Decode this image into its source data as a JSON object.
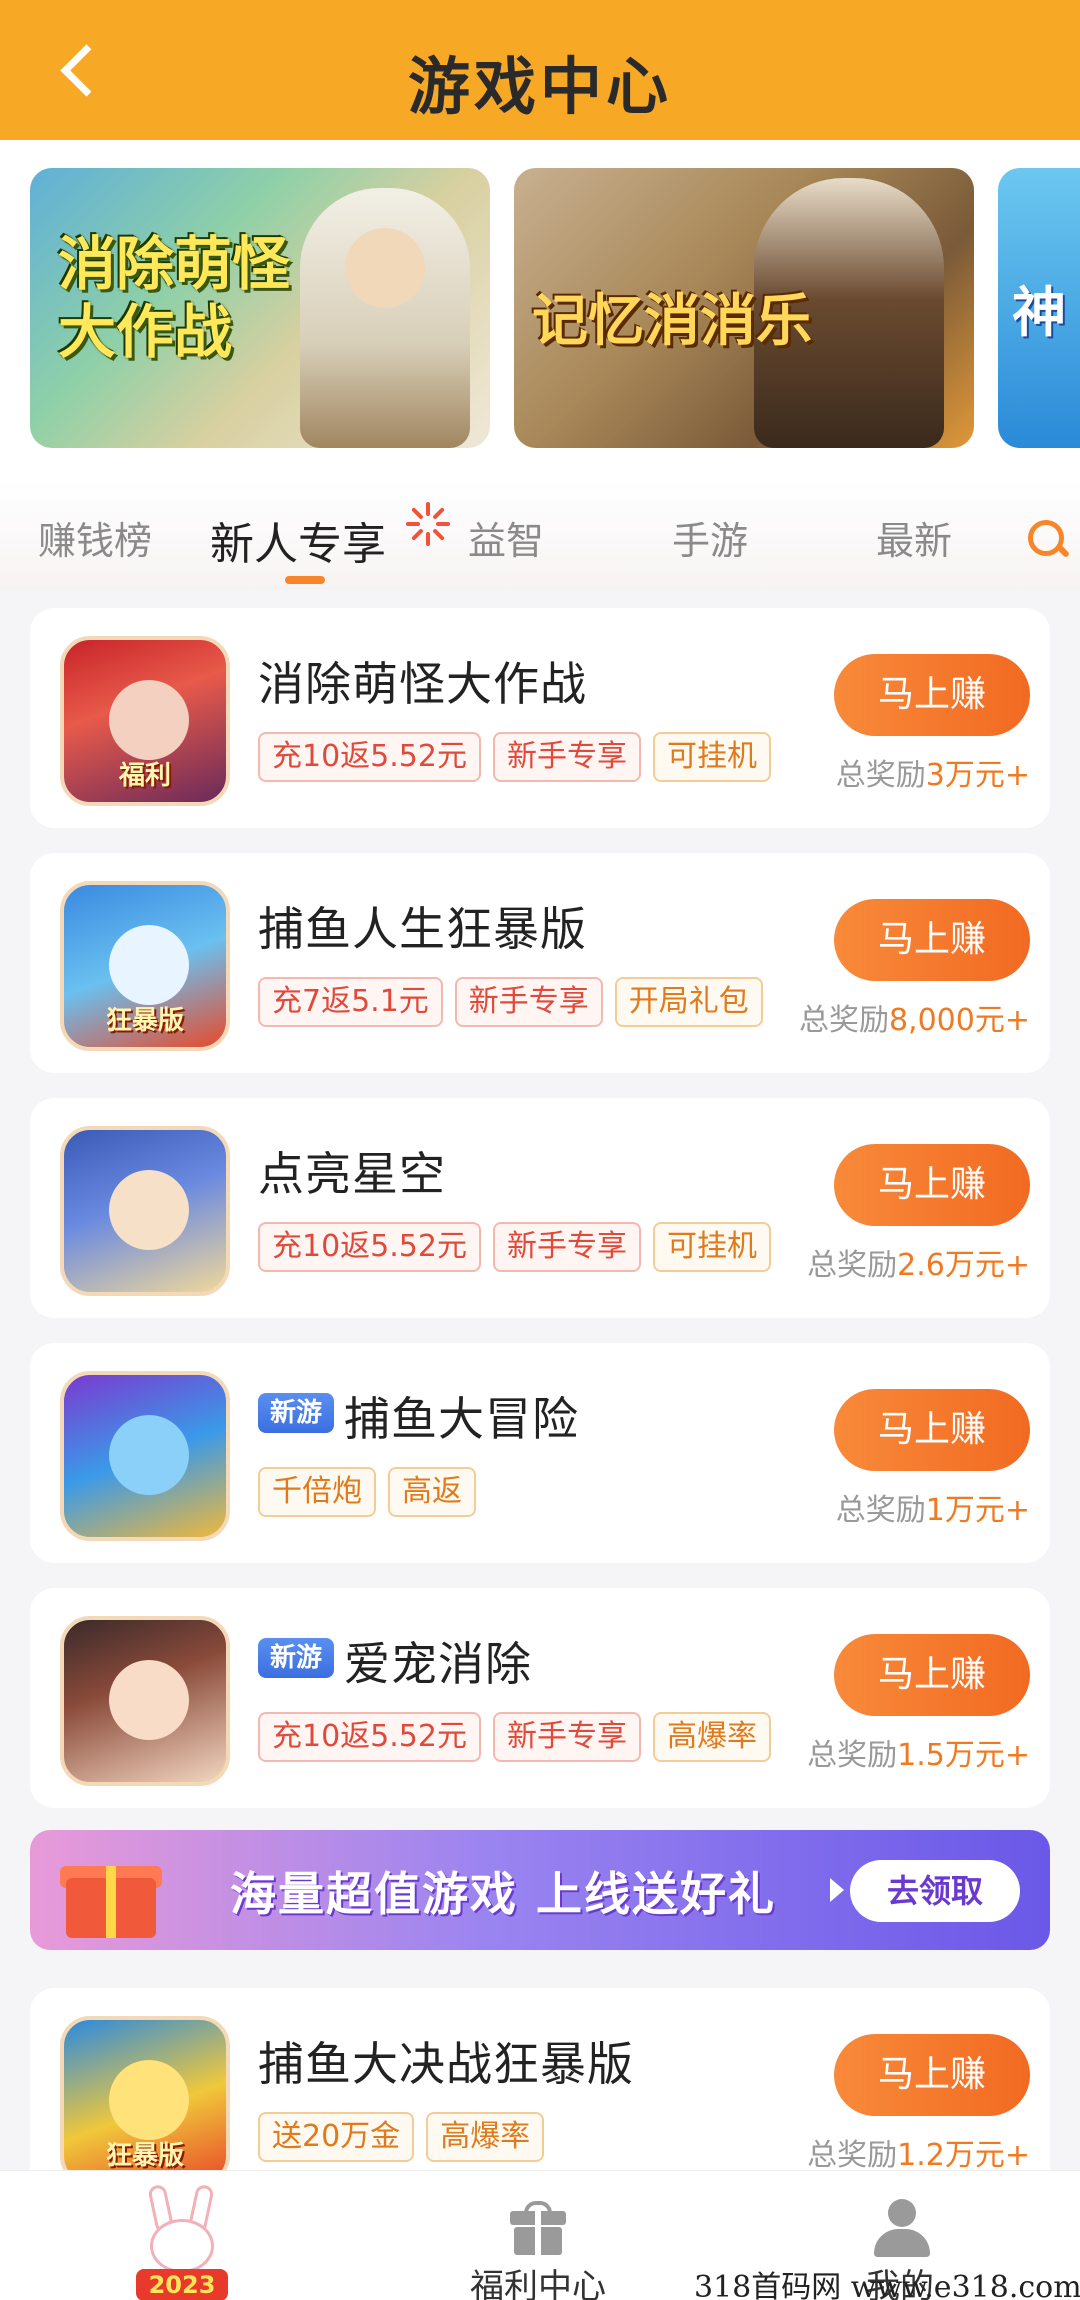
{
  "header": {
    "title": "游戏中心"
  },
  "banners": [
    {
      "title": "消除萌怪大作战"
    },
    {
      "title": "记忆消消乐"
    },
    {
      "title": "神"
    }
  ],
  "tabs": [
    {
      "label": "赚钱榜"
    },
    {
      "label": "新人专享",
      "active": true
    },
    {
      "label": "益智"
    },
    {
      "label": "手游"
    },
    {
      "label": "最新"
    }
  ],
  "games": [
    {
      "name": "消除萌怪大作战",
      "icon_tag": "福利",
      "is_new": false,
      "tags": [
        {
          "text": "充10返5.52元",
          "style": "red"
        },
        {
          "text": "新手专享",
          "style": "red"
        },
        {
          "text": "可挂机",
          "style": "orange"
        }
      ],
      "button": "马上赚",
      "reward_prefix": "总奖励",
      "reward_amount": "3万元+"
    },
    {
      "name": "捕鱼人生狂暴版",
      "icon_tag": "狂暴版",
      "is_new": false,
      "tags": [
        {
          "text": "充7返5.1元",
          "style": "red"
        },
        {
          "text": "新手专享",
          "style": "red"
        },
        {
          "text": "开局礼包",
          "style": "orange"
        }
      ],
      "button": "马上赚",
      "reward_prefix": "总奖励",
      "reward_amount": "8,000元+"
    },
    {
      "name": "点亮星空",
      "icon_tag": "",
      "is_new": false,
      "tags": [
        {
          "text": "充10返5.52元",
          "style": "red"
        },
        {
          "text": "新手专享",
          "style": "red"
        },
        {
          "text": "可挂机",
          "style": "orange"
        }
      ],
      "button": "马上赚",
      "reward_prefix": "总奖励",
      "reward_amount": "2.6万元+"
    },
    {
      "name": "捕鱼大冒险",
      "icon_tag": "",
      "is_new": true,
      "new_label": "新游",
      "tags": [
        {
          "text": "千倍炮",
          "style": "orange"
        },
        {
          "text": "高返",
          "style": "orange"
        }
      ],
      "button": "马上赚",
      "reward_prefix": "总奖励",
      "reward_amount": "1万元+"
    },
    {
      "name": "爱宠消除",
      "icon_tag": "",
      "is_new": true,
      "new_label": "新游",
      "tags": [
        {
          "text": "充10返5.52元",
          "style": "red"
        },
        {
          "text": "新手专享",
          "style": "red"
        },
        {
          "text": "高爆率",
          "style": "orange"
        }
      ],
      "button": "马上赚",
      "reward_prefix": "总奖励",
      "reward_amount": "1.5万元+"
    },
    {
      "name": "捕鱼大决战狂暴版",
      "icon_tag": "狂暴版",
      "is_new": false,
      "tags": [
        {
          "text": "送20万金",
          "style": "orange"
        },
        {
          "text": "高爆率",
          "style": "orange"
        }
      ],
      "button": "马上赚",
      "reward_prefix": "总奖励",
      "reward_amount": "1.2万元+"
    }
  ],
  "promo": {
    "text": "海量超值游戏 上线送好礼",
    "button": "去领取"
  },
  "bottom_nav": {
    "home_badge": "2023",
    "items": [
      {
        "label": "福利中心"
      },
      {
        "label": "我的"
      }
    ]
  },
  "watermark": "318首码网 www.e318.com",
  "colors": {
    "header": "#f7a824",
    "accent": "#f26a22",
    "new_badge": "#3b6fe0"
  }
}
